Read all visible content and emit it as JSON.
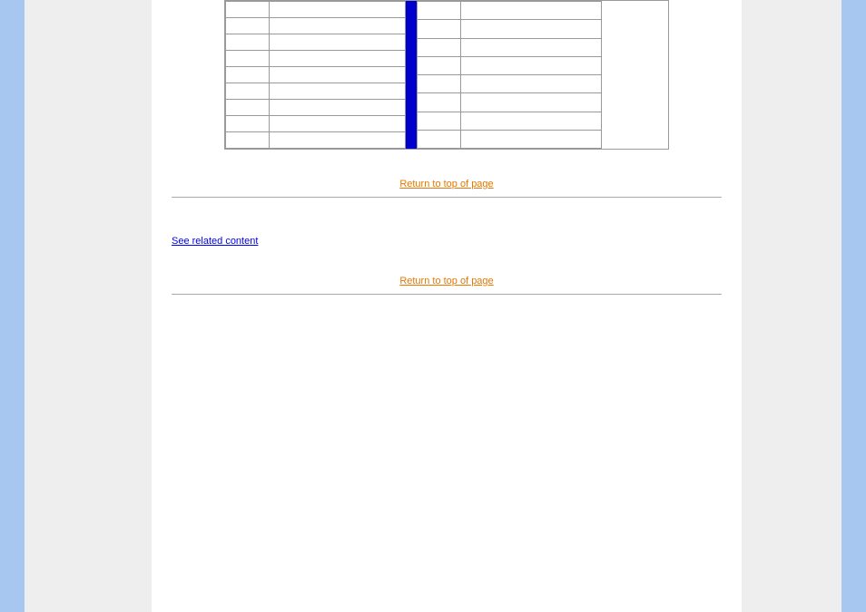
{
  "table_left_rows": 9,
  "table_right_rows": 8,
  "back_to_top_label": "Return to top of page",
  "body_link_label": "See related content",
  "back_to_top_label_2": "Return to top of page"
}
